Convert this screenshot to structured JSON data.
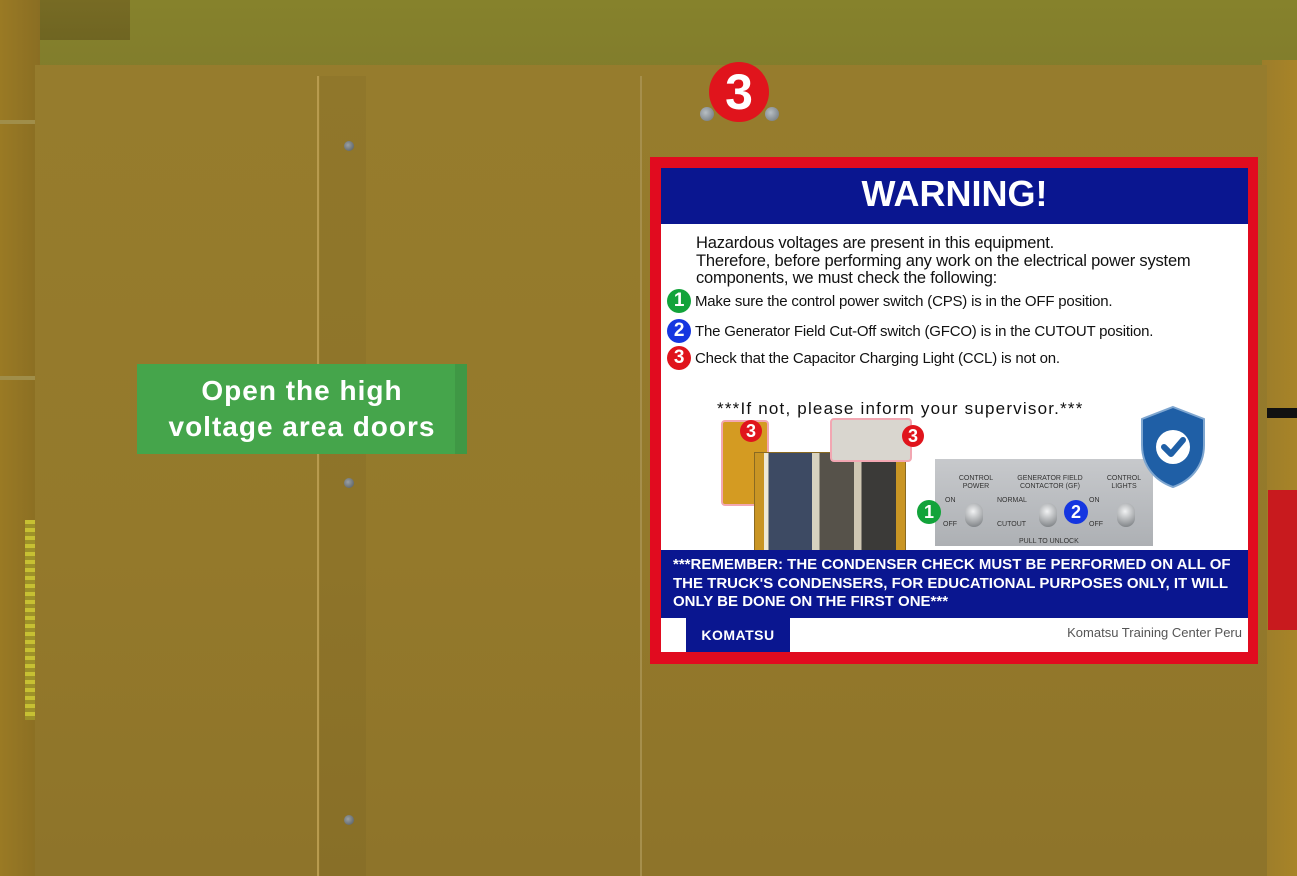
{
  "scene": {
    "hint_text": "Open the high\nvoltage area doors",
    "marker_number": "3"
  },
  "warning_sign": {
    "title": "WARNING!",
    "intro": [
      "Hazardous voltages are present in this equipment.",
      "Therefore, before performing any work on the electrical power system",
      "components, we must check the following:"
    ],
    "items": [
      {
        "num": "1",
        "text": "Make sure the control power switch (CPS) is in the OFF position."
      },
      {
        "num": "2",
        "text": "The Generator Field Cut-Off switch (GFCO) is in the CUTOUT position."
      },
      {
        "num": "3",
        "text": "Check that the Capacitor Charging Light (CCL) is not on."
      }
    ],
    "inform": "***If not, please inform your supervisor.***",
    "photo_pins": [
      "3",
      "3"
    ],
    "switch_panel": {
      "control_power": "CONTROL\nPOWER",
      "generator_field": "GENERATOR FIELD\nCONTACTOR (GF)",
      "control_lights": "CONTROL\nLIGHTS",
      "on_left": "ON",
      "off_left": "OFF",
      "normal": "NORMAL",
      "cutout": "CUTOUT",
      "on_right": "ON",
      "off_right": "OFF",
      "pull_to_unlock": "PULL TO UNLOCK",
      "pins": [
        "1",
        "2"
      ]
    },
    "remember": "***REMEMBER: THE CONDENSER CHECK MUST BE PERFORMED ON ALL OF THE TRUCK'S CONDENSERS, FOR EDUCATIONAL PURPOSES ONLY, IT WILL ONLY BE DONE ON THE FIRST ONE***",
    "logo": "KOMATSU",
    "footer": "Komatsu Training Center Peru"
  },
  "colors": {
    "sign_border": "#e10b1f",
    "sign_header": "#0a1690",
    "hint_background": "#45a54b",
    "marker": "#e0141c",
    "num_1": "#12a33a",
    "num_2": "#1536e0",
    "num_3": "#e0141c"
  }
}
